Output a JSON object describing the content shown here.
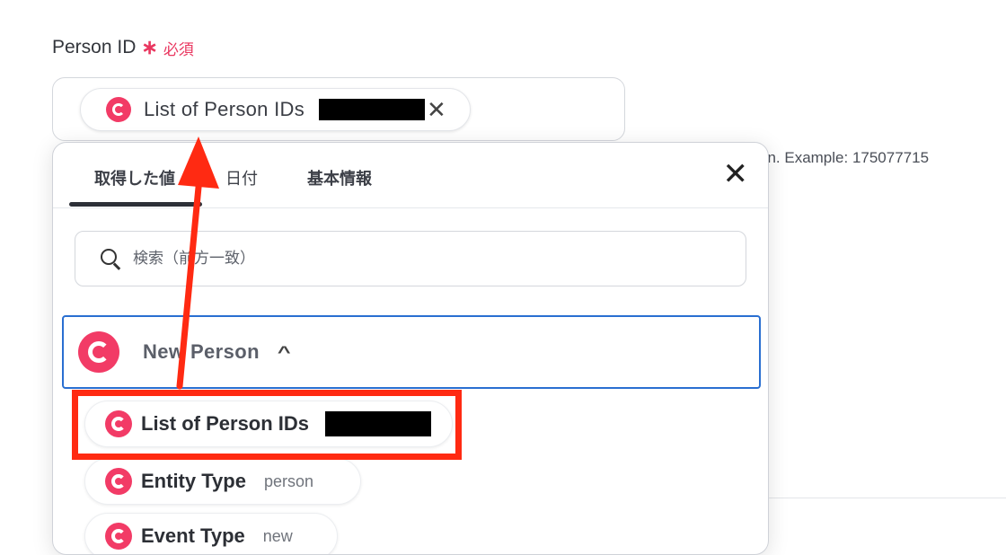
{
  "field": {
    "label": "Person ID",
    "required_star": "∗",
    "required_text": "必須",
    "chip_label": "List of Person IDs",
    "chip_close": "✕",
    "hint_text": "on. Example: 175077715"
  },
  "dropdown": {
    "tabs": [
      "取得した値",
      "日付",
      "基本情報"
    ],
    "close_label": "✕",
    "search_placeholder": "検索（前方一致）",
    "group_title": "New Person",
    "group_caret": "^",
    "items": [
      {
        "label": "List of Person IDs",
        "value": ""
      },
      {
        "label": "Entity Type",
        "value": "person"
      },
      {
        "label": "Event Type",
        "value": "new"
      }
    ]
  },
  "colors": {
    "brand": "#f23b66",
    "required": "#e9365f",
    "focus_border": "#2a6fd1",
    "annotation": "#ff2a12"
  },
  "icons": {
    "app_logo": "yoom-c-logo",
    "search": "magnifier",
    "close": "x-mark",
    "caret": "chevron-up"
  }
}
